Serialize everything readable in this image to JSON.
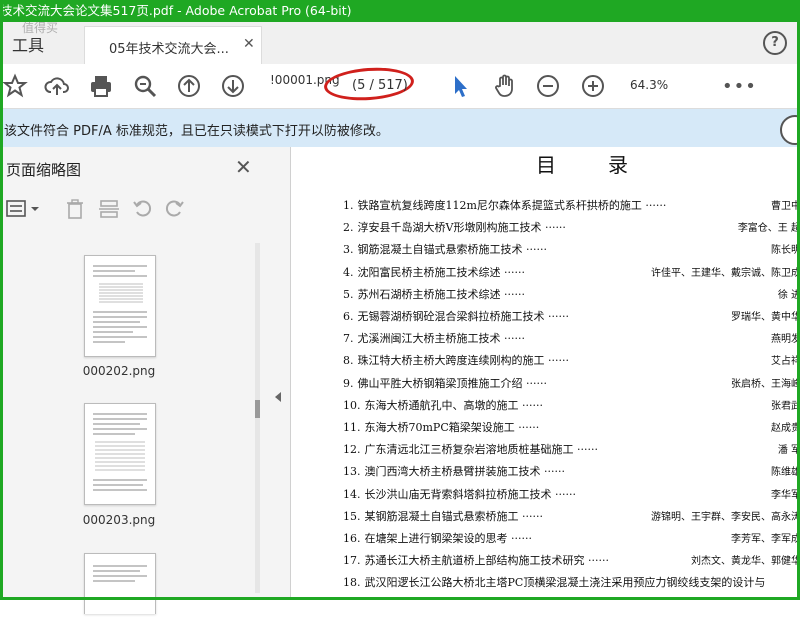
{
  "window": {
    "title": "技术交流大会论文集517页.pdf - Adobe Acrobat Pro (64-bit)"
  },
  "tabs": {
    "tools": "工具",
    "doc": "05年技术交流大会...",
    "watermark": "值得买"
  },
  "toolbar": {
    "page_field": "!00001.png",
    "page_count": "(5 / 517)",
    "zoom": "64.3%",
    "more": "•••"
  },
  "notice": {
    "text": "该文件符合 PDF/A 标准规范，且已在只读模式下打开以防被修改。"
  },
  "sidebar": {
    "title": "页面缩略图",
    "thumbnails": [
      {
        "label": "000202.png"
      },
      {
        "label": "000203.png"
      },
      {
        "label": ""
      }
    ]
  },
  "toc": {
    "title": "目录",
    "entries": [
      {
        "n": "1.",
        "title": "铁路宣杭复线跨度112m尼尔森体系提篮式系杆拱桥的施工",
        "authors": "曹卫中"
      },
      {
        "n": "2.",
        "title": "淳安县千岛湖大桥V形墩刚构施工技术",
        "authors": "李富仓、王 超"
      },
      {
        "n": "3.",
        "title": "钢筋混凝土自锚式悬索桥施工技术",
        "authors": "陈长明"
      },
      {
        "n": "4.",
        "title": "沈阳富民桥主桥施工技术综述",
        "authors": "许佳平、王建华、戴宗诚、陈卫成"
      },
      {
        "n": "5.",
        "title": "苏州石湖桥主桥施工技术综述",
        "authors": "徐 进"
      },
      {
        "n": "6.",
        "title": "无锡蓉湖桥钢砼混合梁斜拉桥施工技术",
        "authors": "罗瑞华、黄中华"
      },
      {
        "n": "7.",
        "title": "尤溪洲闽江大桥主桥施工技术",
        "authors": "燕明发"
      },
      {
        "n": "8.",
        "title": "珠江特大桥主桥大跨度连续刚构的施工",
        "authors": "艾占祥"
      },
      {
        "n": "9.",
        "title": "佛山平胜大桥钢箱梁顶推施工介绍",
        "authors": "张启桥、王海峰"
      },
      {
        "n": "10.",
        "title": "东海大桥通航孔中、高墩的施工",
        "authors": "张君武"
      },
      {
        "n": "11.",
        "title": "东海大桥70mPC箱梁架设施工",
        "authors": "赵成贵"
      },
      {
        "n": "12.",
        "title": "广东清远北江三桥复杂岩溶地质桩基础施工",
        "authors": "潘 军"
      },
      {
        "n": "13.",
        "title": "澳门西湾大桥主桥悬臂拼装施工技术",
        "authors": "陈维雄"
      },
      {
        "n": "14.",
        "title": "长沙洪山庙无背索斜塔斜拉桥施工技术",
        "authors": "李华军"
      },
      {
        "n": "15.",
        "title": "某钢筋混凝土自锚式悬索桥施工",
        "authors": "游锦明、王宇群、李安民、高永涛"
      },
      {
        "n": "16.",
        "title": "在塘架上进行钢梁架设的思考",
        "authors": "李芳军、李军成"
      },
      {
        "n": "17.",
        "title": "苏通长江大桥主航道桥上部结构施工技术研究",
        "authors": "刘杰文、黄龙华、郭健华"
      },
      {
        "n": "18.",
        "title": "武汉阳逻长江公路大桥北主塔PC顶横梁混凝土浇注采用预应力钢绞线支架的设计与",
        "authors": ""
      }
    ]
  }
}
